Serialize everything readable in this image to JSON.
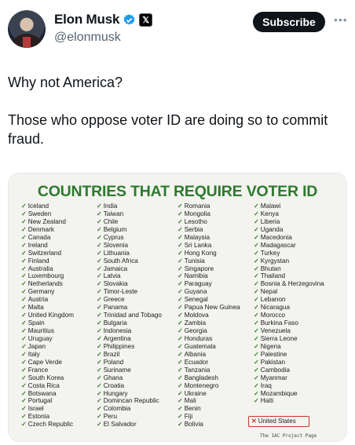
{
  "author": {
    "name": "Elon Musk",
    "handle": "@elonmusk",
    "subscribe_label": "Subscribe",
    "verified_icon": "verified-badge-icon",
    "affiliate_icon": "x-logo-icon",
    "more_icon": "more-horizontal-icon"
  },
  "tweet": {
    "line1": "Why not America?",
    "line2": "Those who oppose voter ID are doing so to commit fraud."
  },
  "image": {
    "title": "COUNTRIES THAT REQUIRE VOTER ID",
    "title_color": "#2d7a2d",
    "check_color": "#3a7d2c",
    "columns": [
      [
        "Iceland",
        "Sweden",
        "New Zealand",
        "Denmark",
        "Canada",
        "Ireland",
        "Switzerland",
        "Finland",
        "Australia",
        "Luxembourg",
        "Netherlands",
        "Germany",
        "Austria",
        "Malta",
        "United Kingdom",
        "Spain",
        "Mauritius",
        "Uruguay",
        "Japan",
        "Italy",
        "Cape Verde",
        "France",
        "South Korea",
        "Costa Rica",
        "Botswana",
        "Portugal",
        "Israel",
        "Estonia",
        "Czech Republic"
      ],
      [
        "India",
        "Taiwan",
        "Chile",
        "Belgium",
        "Cyprus",
        "Slovenia",
        "Lithuania",
        "South Africa",
        "Jamaica",
        "Latvia",
        "Slovakia",
        "Timor-Leste",
        "Greece",
        "Panama",
        "Trinidad and Tobago",
        "Bulgaria",
        "Indonesia",
        "Argentina",
        "Philippines",
        "Brazil",
        "Poland",
        "Suriname",
        "Ghana",
        "Croatia",
        "Hungary",
        "Domincan Republic",
        "Colombia",
        "Peru",
        "El Salvador"
      ],
      [
        "Romania",
        "Mongolia",
        "Lesotho",
        "Serbia",
        "Malaysia",
        "Sri Lanka",
        "Hong Kong",
        "Tunisia",
        "Singapore",
        "Namibia",
        "Paraguay",
        "Guyana",
        "Senegal",
        "Papua New Guinea",
        "Moldova",
        "Zambia",
        "Georgia",
        "Honduras",
        "Guatemala",
        "Albania",
        "Ecuador",
        "Tanzania",
        "Bangladesh",
        "Montenegro",
        "Ukraine",
        "Mali",
        "Benin",
        "Fiji",
        "Bolivia"
      ],
      [
        "Malawi",
        "Kenya",
        "Liberia",
        "Uganda",
        "Macedonia",
        "Madagascar",
        "Turkey",
        "Kyrgystan",
        "Bhutan",
        "Thailand",
        "Bosnia & Herzegovina",
        "Nepal",
        "Lebanon",
        "Nicaragua",
        "Morocco",
        "Burkina Faso",
        "Venezuela",
        "Sierra Leone",
        "Nigeria",
        "Palestine",
        "Pakistan",
        "Cambodia",
        "Myanmar",
        "Iraq",
        "Mozambique",
        "Haiti"
      ]
    ],
    "excluded": "United States",
    "credit": "The IAC Project Page"
  }
}
